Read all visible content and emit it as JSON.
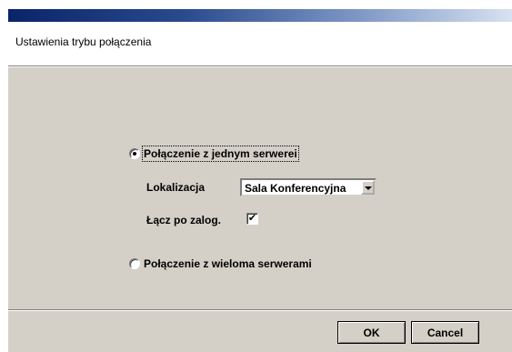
{
  "dialog": {
    "title": "Ustawienia trybu połączenia"
  },
  "options": {
    "single_server": {
      "label": "Połączenie z jednym serwerei",
      "selected": true
    },
    "location": {
      "label": "Lokalizacja",
      "value": "Sala Konferencyjna"
    },
    "connect_after_login": {
      "label": "Łącz po zalog.",
      "checked": true,
      "check_glyph": "✔"
    },
    "multi_server": {
      "label": "Połączenie z wieloma serwerami",
      "selected": false
    }
  },
  "footer": {
    "ok_label": "OK",
    "cancel_label": "Cancel"
  },
  "colors": {
    "dialog_face": "#d4d0c8",
    "titlebar_start": "#0a246a",
    "titlebar_end": "#d8e2f0"
  }
}
